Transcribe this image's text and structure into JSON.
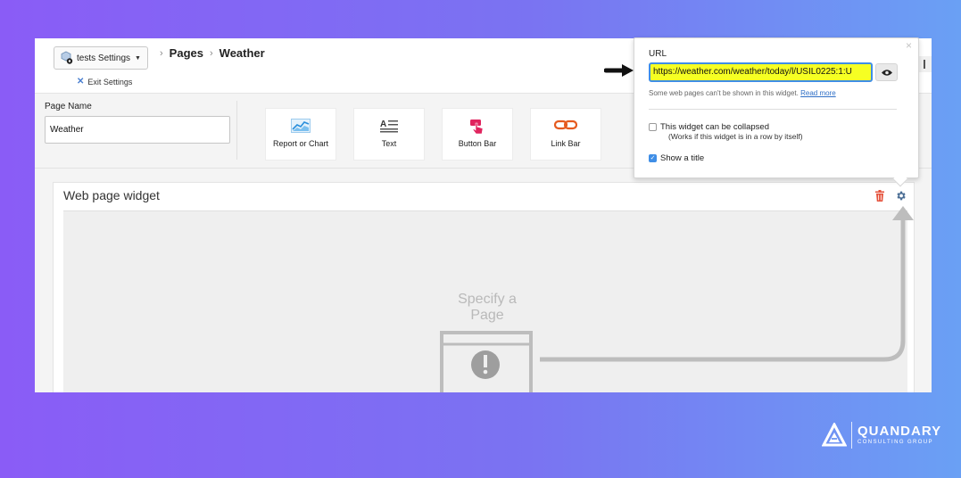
{
  "header": {
    "app_select": "tests Settings",
    "exit_label": "Exit Settings",
    "breadcrumb": [
      "Pages",
      "Weather"
    ]
  },
  "page_name": {
    "label": "Page Name",
    "value": "Weather"
  },
  "tools": [
    {
      "label": "Report or Chart",
      "icon": "chart-icon"
    },
    {
      "label": "Text",
      "icon": "text-icon"
    },
    {
      "label": "Button Bar",
      "icon": "button-bar-icon"
    },
    {
      "label": "Link Bar",
      "icon": "link-icon"
    }
  ],
  "widget": {
    "title": "Web page widget",
    "placeholder": "Specify a Page"
  },
  "popup": {
    "url_label": "URL",
    "url_value": "https://weather.com/weather/today/l/USIL0225:1:U",
    "note": "Some web pages can't be shown in this widget.",
    "read_more": "Read more",
    "collapse_label": "This widget can be collapsed",
    "collapse_checked": false,
    "collapse_sub": "(Works if this widget is in a row by itself)",
    "title_label": "Show a title",
    "title_checked": true
  },
  "brand": {
    "name": "QUANDARY",
    "tagline": "CONSULTING GROUP"
  },
  "colors": {
    "accent": "#3f8ee6",
    "highlight": "#f6ff23",
    "delete": "#e5533d"
  }
}
